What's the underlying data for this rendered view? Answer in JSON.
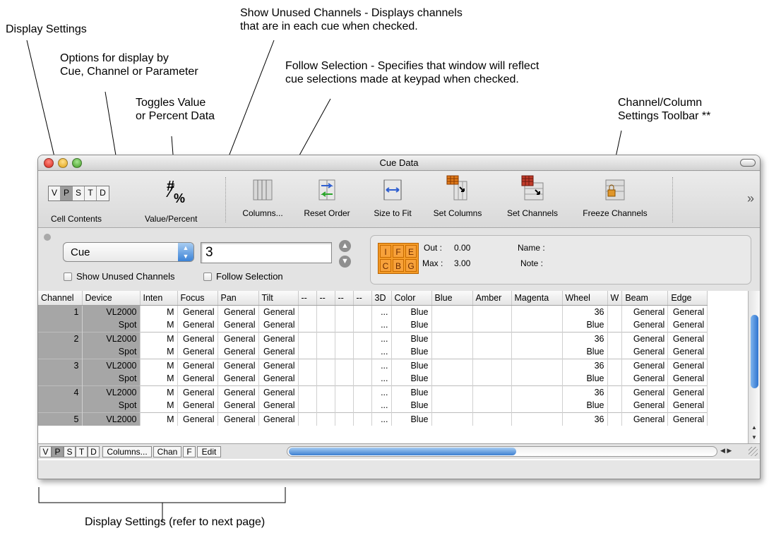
{
  "annotations": {
    "display_settings": "Display Settings",
    "options_line1": "Options for display by",
    "options_line2": "Cue, Channel or Parameter",
    "toggles_line1": "Toggles Value",
    "toggles_line2": "or Percent Data",
    "unused_line1": "Show Unused Channels - Displays channels",
    "unused_line2": "that are in each cue when checked.",
    "follow_line1": "Follow Selection - Specifies that window will reflect",
    "follow_line2": "cue selections made at keypad when checked.",
    "chan_col_line1": "Channel/Column",
    "chan_col_line2": "Settings Toolbar **",
    "bottom_caption": "Display Settings (refer to next page)"
  },
  "window": {
    "title": "Cue Data"
  },
  "toolbar": {
    "cell_contents_buttons": [
      "V",
      "P",
      "S",
      "T",
      "D"
    ],
    "cell_contents_selected": "P",
    "cell_contents_label": "Cell Contents",
    "value_percent_glyph_top": "#",
    "value_percent_glyph_bottom": "%",
    "value_percent_label": "Value/Percent",
    "tools": [
      {
        "label": "Columns...",
        "icon": "columns-icon"
      },
      {
        "label": "Reset Order",
        "icon": "reset-order-icon"
      },
      {
        "label": "Size to Fit",
        "icon": "size-to-fit-icon"
      },
      {
        "label": "Set Columns",
        "icon": "set-columns-icon"
      },
      {
        "label": "Set Channels",
        "icon": "set-channels-icon"
      },
      {
        "label": "Freeze Channels",
        "icon": "freeze-channels-icon"
      }
    ],
    "overflow": "»"
  },
  "controls": {
    "display_by": "Cue",
    "cue_number": "3",
    "show_unused": "Show Unused Channels",
    "follow_selection": "Follow Selection",
    "cue_flags": [
      "I",
      "F",
      "E",
      "C",
      "B",
      "G"
    ],
    "out_label": "Out :",
    "out_value": "0.00",
    "max_label": "Max :",
    "max_value": "3.00",
    "name_label": "Name :",
    "note_label": "Note :"
  },
  "grid": {
    "columns": [
      "Channel",
      "Device",
      "Inten",
      "Focus",
      "Pan",
      "Tilt",
      "--",
      "--",
      "--",
      "--",
      "3D",
      "Color",
      "Blue",
      "Amber",
      "Magenta",
      "Wheel",
      "W",
      "Beam",
      "Edge"
    ],
    "rows": [
      [
        "1",
        "VL2000",
        "M",
        "General",
        "General",
        "General",
        "",
        "",
        "",
        "",
        "...",
        "Blue",
        "",
        "",
        "",
        "36",
        "",
        "General",
        "General"
      ],
      [
        "",
        "Spot",
        "M",
        "General",
        "General",
        "General",
        "",
        "",
        "",
        "",
        "...",
        "Blue",
        "",
        "",
        "",
        "Blue",
        "",
        "General",
        "General"
      ],
      [
        "2",
        "VL2000",
        "M",
        "General",
        "General",
        "General",
        "",
        "",
        "",
        "",
        "...",
        "Blue",
        "",
        "",
        "",
        "36",
        "",
        "General",
        "General"
      ],
      [
        "",
        "Spot",
        "M",
        "General",
        "General",
        "General",
        "",
        "",
        "",
        "",
        "...",
        "Blue",
        "",
        "",
        "",
        "Blue",
        "",
        "General",
        "General"
      ],
      [
        "3",
        "VL2000",
        "M",
        "General",
        "General",
        "General",
        "",
        "",
        "",
        "",
        "...",
        "Blue",
        "",
        "",
        "",
        "36",
        "",
        "General",
        "General"
      ],
      [
        "",
        "Spot",
        "M",
        "General",
        "General",
        "General",
        "",
        "",
        "",
        "",
        "...",
        "Blue",
        "",
        "",
        "",
        "Blue",
        "",
        "General",
        "General"
      ],
      [
        "4",
        "VL2000",
        "M",
        "General",
        "General",
        "General",
        "",
        "",
        "",
        "",
        "...",
        "Blue",
        "",
        "",
        "",
        "36",
        "",
        "General",
        "General"
      ],
      [
        "",
        "Spot",
        "M",
        "General",
        "General",
        "General",
        "",
        "",
        "",
        "",
        "...",
        "Blue",
        "",
        "",
        "",
        "Blue",
        "",
        "General",
        "General"
      ],
      [
        "5",
        "VL2000",
        "M",
        "General",
        "General",
        "General",
        "",
        "",
        "",
        "",
        "...",
        "Blue",
        "",
        "",
        "",
        "36",
        "",
        "General",
        "General"
      ]
    ]
  },
  "bottombar": {
    "buttons": [
      "V",
      "P",
      "S",
      "T",
      "D"
    ],
    "selected": "P",
    "columns": "Columns...",
    "chan": "Chan",
    "f": "F",
    "edit": "Edit"
  }
}
